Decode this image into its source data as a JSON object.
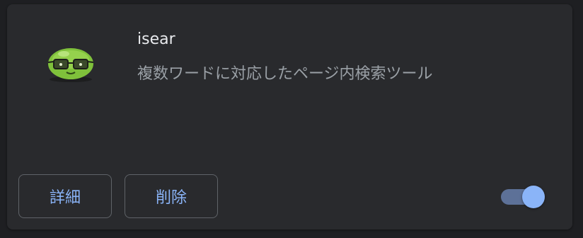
{
  "extension": {
    "name": "isear",
    "description": "複数ワードに対応したページ内検索ツール",
    "icon": "green-bean-with-glasses-icon",
    "enabled": true
  },
  "buttons": {
    "details_label": "詳細",
    "remove_label": "削除"
  },
  "colors": {
    "background": "#1e1f22",
    "card": "#292a2d",
    "accent": "#8ab4f8",
    "toggle_track": "#5d7198",
    "name_text": "#e8eaed",
    "description_text": "#9aa0a6",
    "button_border": "#5f6368"
  }
}
